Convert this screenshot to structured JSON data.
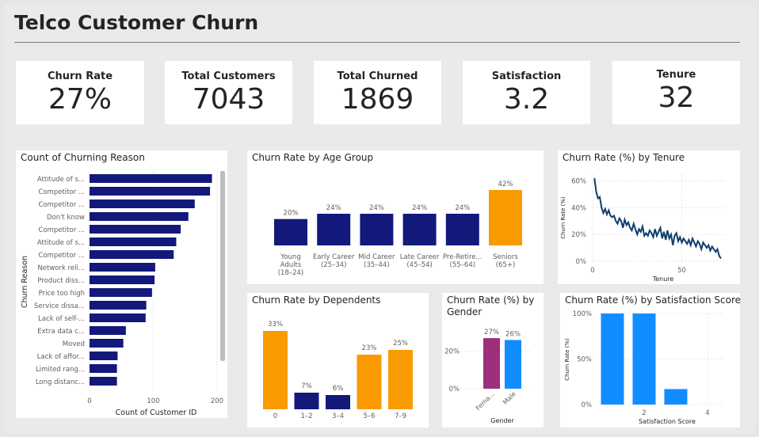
{
  "title": "Telco Customer Churn",
  "kpis": [
    {
      "label": "Churn Rate",
      "value": "27%"
    },
    {
      "label": "Total Customers",
      "value": "7043"
    },
    {
      "label": "Total Churned",
      "value": "1869"
    },
    {
      "label": "Satisfaction",
      "value": "3.2"
    },
    {
      "label": "Tenure",
      "value": "32"
    }
  ],
  "colors": {
    "navy": "#13197a",
    "orange": "#f99b00",
    "blue": "#118dff",
    "purple": "#9e2f7c",
    "line": "#0f3e6e"
  },
  "chart_data": [
    {
      "type": "bar",
      "orientation": "horizontal",
      "title": "Count of Churning Reason",
      "ylabel": "Churn Reason",
      "xlabel": "Count of Customer ID",
      "categories": [
        "Attitude of s...",
        "Competitor ...",
        "Competitor ...",
        "Don't know",
        "Competitor ...",
        "Attitude of s...",
        "Competitor ...",
        "Network reli...",
        "Product diss...",
        "Price too high",
        "Service dissa...",
        "Lack of self-...",
        "Extra data c...",
        "Moved",
        "Lack of affor...",
        "Limited rang...",
        "Long distanc..."
      ],
      "values": [
        192,
        189,
        165,
        155,
        143,
        136,
        132,
        103,
        102,
        98,
        89,
        88,
        57,
        53,
        44,
        43,
        43
      ],
      "xticks": [
        "0",
        "100",
        "200"
      ],
      "xlim": [
        0,
        210
      ]
    },
    {
      "type": "bar",
      "title": "Churn Rate by Age Group",
      "categories": [
        [
          "Young",
          "Adults",
          "(18–24)"
        ],
        [
          "Early Career",
          "(25–34)"
        ],
        [
          "Mid Career",
          "(35–44)"
        ],
        [
          "Late Career",
          "(45–54)"
        ],
        [
          "Pre-Retire...",
          "(55–64)"
        ],
        [
          "Seniors",
          "(65+)"
        ]
      ],
      "values": [
        20,
        24,
        24,
        24,
        24,
        42
      ],
      "labels": [
        "20%",
        "24%",
        "24%",
        "24%",
        "24%",
        "42%"
      ],
      "highlight": [
        false,
        false,
        false,
        false,
        false,
        true
      ],
      "ylim": [
        0,
        45
      ]
    },
    {
      "type": "line",
      "title": "Churn Rate (%) by Tenure",
      "xlabel": "Tenure",
      "ylabel": "Churn Rate (%)",
      "x": [
        1,
        2,
        3,
        4,
        5,
        6,
        7,
        8,
        9,
        10,
        11,
        12,
        13,
        14,
        15,
        16,
        17,
        18,
        19,
        20,
        21,
        22,
        23,
        24,
        25,
        26,
        27,
        28,
        29,
        30,
        31,
        32,
        33,
        34,
        35,
        36,
        37,
        38,
        39,
        40,
        41,
        42,
        43,
        44,
        45,
        46,
        47,
        48,
        49,
        50,
        51,
        52,
        53,
        54,
        55,
        56,
        57,
        58,
        59,
        60,
        61,
        62,
        63,
        64,
        65,
        66,
        67,
        68,
        69,
        70,
        71,
        72
      ],
      "y": [
        62,
        52,
        47,
        48,
        40,
        36,
        39,
        35,
        38,
        34,
        33,
        34,
        30,
        28,
        32,
        30,
        25,
        31,
        27,
        29,
        25,
        23,
        28,
        24,
        20,
        24,
        22,
        26,
        19,
        21,
        19,
        23,
        21,
        18,
        24,
        19,
        22,
        25,
        17,
        22,
        16,
        23,
        17,
        20,
        12,
        19,
        21,
        15,
        18,
        14,
        17,
        15,
        13,
        16,
        12,
        17,
        14,
        11,
        15,
        13,
        9,
        14,
        12,
        10,
        12,
        8,
        11,
        9,
        7,
        9,
        4,
        2
      ],
      "yticks": [
        "0%",
        "20%",
        "40%",
        "60%"
      ],
      "xticks": [
        "0",
        "50"
      ],
      "xlim": [
        0,
        72
      ],
      "ylim": [
        0,
        65
      ]
    },
    {
      "type": "bar",
      "title": "Churn Rate by Dependents",
      "categories": [
        "0",
        "1–2",
        "3–4",
        "5–6",
        "7–9"
      ],
      "values": [
        33,
        7,
        6,
        23,
        25
      ],
      "labels": [
        "33%",
        "7%",
        "6%",
        "23%",
        "25%"
      ],
      "highlight": [
        true,
        false,
        false,
        true,
        true
      ],
      "ylim": [
        0,
        35
      ]
    },
    {
      "type": "bar",
      "title": "Churn Rate (%) by Gender",
      "xlabel": "Gender",
      "categories": [
        "Fema...",
        "Male"
      ],
      "values": [
        27,
        26
      ],
      "labels": [
        "27%",
        "26%"
      ],
      "yticks": [
        "0%",
        "20%"
      ],
      "ylim": [
        0,
        30
      ]
    },
    {
      "type": "bar",
      "title": "Churn Rate (%) by Satisfaction Score",
      "xlabel": "Satisfaction Score",
      "ylabel": "Churn Rate (%)",
      "x": [
        1,
        2,
        3
      ],
      "values": [
        100,
        100,
        17
      ],
      "xticks": [
        "2",
        "4"
      ],
      "yticks": [
        "0%",
        "50%",
        "100%"
      ],
      "ylim": [
        0,
        100
      ]
    }
  ]
}
